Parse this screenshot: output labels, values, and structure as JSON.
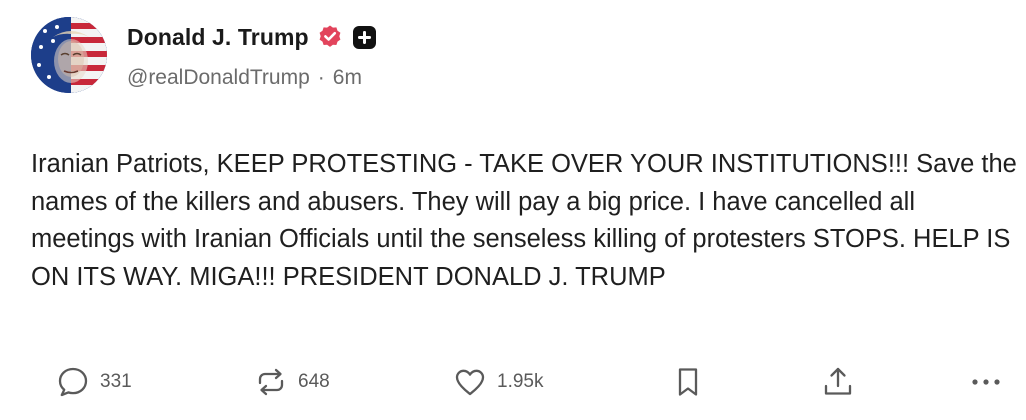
{
  "author": {
    "display_name": "Donald J. Trump",
    "handle": "@realDonaldTrump",
    "separator": "·",
    "time_ago": "6m",
    "verified_color": "#e2445c"
  },
  "post": {
    "text": "Iranian Patriots, KEEP PROTESTING - TAKE OVER YOUR INSTITUTIONS!!! Save the names of the killers and abusers. They will pay a big price. I have cancelled all meetings with Iranian Officials until the senseless killing of protesters STOPS. HELP IS ON ITS WAY. MIGA!!! PRESIDENT DONALD J. TRUMP"
  },
  "actions": {
    "replies": "331",
    "reposts": "648",
    "likes": "1.95k",
    "icons": [
      "reply-icon",
      "repost-icon",
      "like-icon",
      "bookmark-icon",
      "share-icon",
      "more-icon"
    ]
  }
}
